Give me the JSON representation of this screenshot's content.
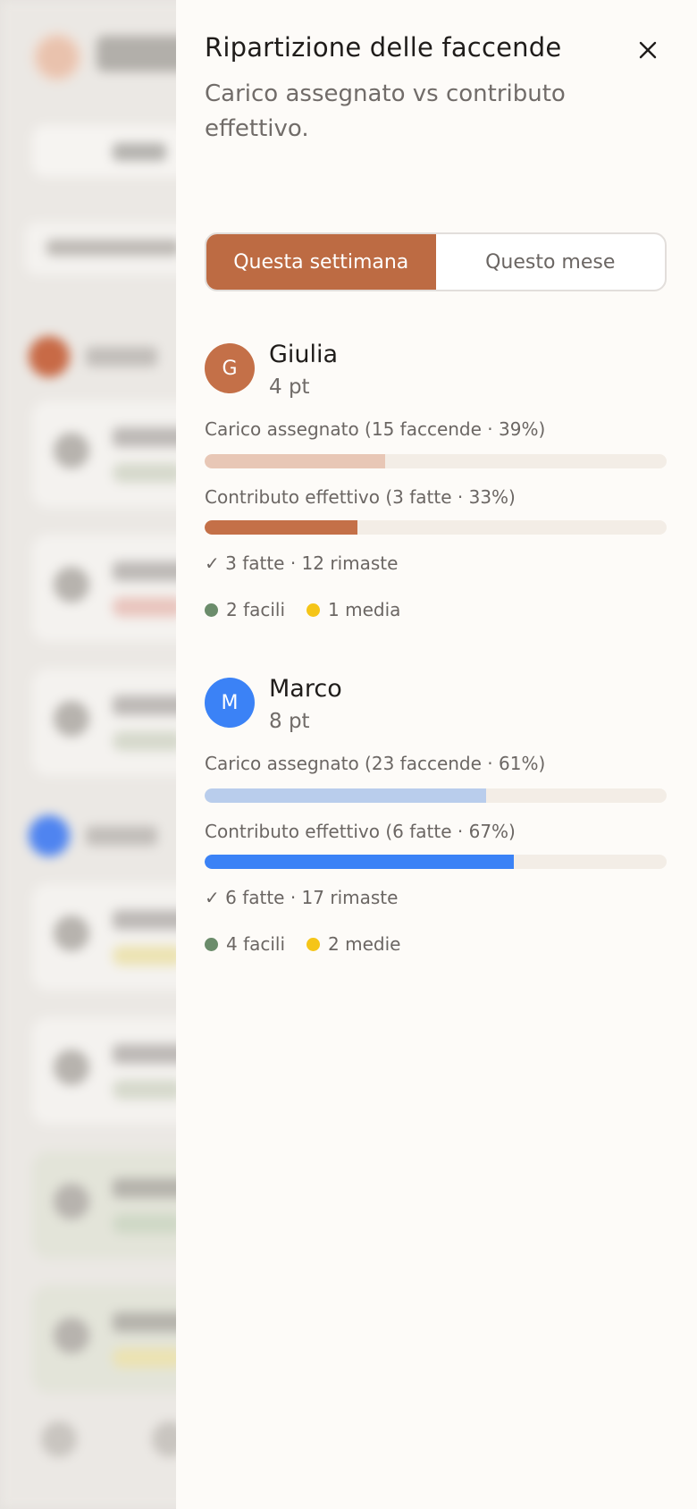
{
  "drawer": {
    "title": "Ripartizione delle faccende",
    "subtitle": "Carico assegnato vs contributo effettivo.",
    "close_icon": "close-icon"
  },
  "period_toggle": {
    "options": [
      "Questa settimana",
      "Questo mese"
    ],
    "selected": "Questa settimana"
  },
  "people": [
    {
      "initial": "G",
      "name": "Giulia",
      "points": "4 pt",
      "color": "#c47048",
      "assigned_color": "#e8c7b6",
      "contribution_color": "#c47048",
      "assigned_label": "Carico assegnato (15 faccende · 39%)",
      "assigned_percent": 39,
      "contribution_label": "Contributo effettivo (3 fatte · 33%)",
      "contribution_percent": 33,
      "done_summary": "✓ 3 fatte · 12 rimaste",
      "legend": [
        {
          "label": "2 facili",
          "color": "#6b8c6b"
        },
        {
          "label": "1 media",
          "color": "#f5c518"
        }
      ]
    },
    {
      "initial": "M",
      "name": "Marco",
      "points": "8 pt",
      "color": "#3b82f6",
      "assigned_color": "#b9cdec",
      "contribution_color": "#3b82f6",
      "assigned_label": "Carico assegnato (23 faccende · 61%)",
      "assigned_percent": 61,
      "contribution_label": "Contributo effettivo (6 fatte · 67%)",
      "contribution_percent": 67,
      "done_summary": "✓ 6 fatte · 17 rimaste",
      "legend": [
        {
          "label": "4 facili",
          "color": "#6b8c6b"
        },
        {
          "label": "2 medie",
          "color": "#f5c518"
        }
      ]
    }
  ]
}
